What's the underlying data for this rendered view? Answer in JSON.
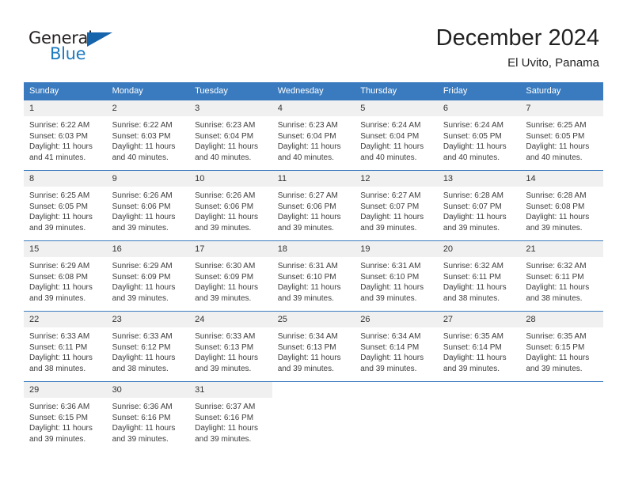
{
  "logo": {
    "word_top": "General",
    "word_bottom": "Blue",
    "triangle_color": "#1664ab",
    "blue_color": "#1c7ac0"
  },
  "header": {
    "title": "December 2024",
    "subtitle": "El Uvito, Panama"
  },
  "theme": {
    "header_bg": "#3a7bbf",
    "header_text": "#ffffff",
    "daynum_bg": "#f0f0f0",
    "cell_bg": "#ffffff",
    "text": "#3d3d3d"
  },
  "weekdays": [
    "Sunday",
    "Monday",
    "Tuesday",
    "Wednesday",
    "Thursday",
    "Friday",
    "Saturday"
  ],
  "weeks": [
    [
      {
        "day": "1",
        "sunrise": "Sunrise: 6:22 AM",
        "sunset": "Sunset: 6:03 PM",
        "daylight": "Daylight: 11 hours and 41 minutes."
      },
      {
        "day": "2",
        "sunrise": "Sunrise: 6:22 AM",
        "sunset": "Sunset: 6:03 PM",
        "daylight": "Daylight: 11 hours and 40 minutes."
      },
      {
        "day": "3",
        "sunrise": "Sunrise: 6:23 AM",
        "sunset": "Sunset: 6:04 PM",
        "daylight": "Daylight: 11 hours and 40 minutes."
      },
      {
        "day": "4",
        "sunrise": "Sunrise: 6:23 AM",
        "sunset": "Sunset: 6:04 PM",
        "daylight": "Daylight: 11 hours and 40 minutes."
      },
      {
        "day": "5",
        "sunrise": "Sunrise: 6:24 AM",
        "sunset": "Sunset: 6:04 PM",
        "daylight": "Daylight: 11 hours and 40 minutes."
      },
      {
        "day": "6",
        "sunrise": "Sunrise: 6:24 AM",
        "sunset": "Sunset: 6:05 PM",
        "daylight": "Daylight: 11 hours and 40 minutes."
      },
      {
        "day": "7",
        "sunrise": "Sunrise: 6:25 AM",
        "sunset": "Sunset: 6:05 PM",
        "daylight": "Daylight: 11 hours and 40 minutes."
      }
    ],
    [
      {
        "day": "8",
        "sunrise": "Sunrise: 6:25 AM",
        "sunset": "Sunset: 6:05 PM",
        "daylight": "Daylight: 11 hours and 39 minutes."
      },
      {
        "day": "9",
        "sunrise": "Sunrise: 6:26 AM",
        "sunset": "Sunset: 6:06 PM",
        "daylight": "Daylight: 11 hours and 39 minutes."
      },
      {
        "day": "10",
        "sunrise": "Sunrise: 6:26 AM",
        "sunset": "Sunset: 6:06 PM",
        "daylight": "Daylight: 11 hours and 39 minutes."
      },
      {
        "day": "11",
        "sunrise": "Sunrise: 6:27 AM",
        "sunset": "Sunset: 6:06 PM",
        "daylight": "Daylight: 11 hours and 39 minutes."
      },
      {
        "day": "12",
        "sunrise": "Sunrise: 6:27 AM",
        "sunset": "Sunset: 6:07 PM",
        "daylight": "Daylight: 11 hours and 39 minutes."
      },
      {
        "day": "13",
        "sunrise": "Sunrise: 6:28 AM",
        "sunset": "Sunset: 6:07 PM",
        "daylight": "Daylight: 11 hours and 39 minutes."
      },
      {
        "day": "14",
        "sunrise": "Sunrise: 6:28 AM",
        "sunset": "Sunset: 6:08 PM",
        "daylight": "Daylight: 11 hours and 39 minutes."
      }
    ],
    [
      {
        "day": "15",
        "sunrise": "Sunrise: 6:29 AM",
        "sunset": "Sunset: 6:08 PM",
        "daylight": "Daylight: 11 hours and 39 minutes."
      },
      {
        "day": "16",
        "sunrise": "Sunrise: 6:29 AM",
        "sunset": "Sunset: 6:09 PM",
        "daylight": "Daylight: 11 hours and 39 minutes."
      },
      {
        "day": "17",
        "sunrise": "Sunrise: 6:30 AM",
        "sunset": "Sunset: 6:09 PM",
        "daylight": "Daylight: 11 hours and 39 minutes."
      },
      {
        "day": "18",
        "sunrise": "Sunrise: 6:31 AM",
        "sunset": "Sunset: 6:10 PM",
        "daylight": "Daylight: 11 hours and 39 minutes."
      },
      {
        "day": "19",
        "sunrise": "Sunrise: 6:31 AM",
        "sunset": "Sunset: 6:10 PM",
        "daylight": "Daylight: 11 hours and 39 minutes."
      },
      {
        "day": "20",
        "sunrise": "Sunrise: 6:32 AM",
        "sunset": "Sunset: 6:11 PM",
        "daylight": "Daylight: 11 hours and 38 minutes."
      },
      {
        "day": "21",
        "sunrise": "Sunrise: 6:32 AM",
        "sunset": "Sunset: 6:11 PM",
        "daylight": "Daylight: 11 hours and 38 minutes."
      }
    ],
    [
      {
        "day": "22",
        "sunrise": "Sunrise: 6:33 AM",
        "sunset": "Sunset: 6:11 PM",
        "daylight": "Daylight: 11 hours and 38 minutes."
      },
      {
        "day": "23",
        "sunrise": "Sunrise: 6:33 AM",
        "sunset": "Sunset: 6:12 PM",
        "daylight": "Daylight: 11 hours and 38 minutes."
      },
      {
        "day": "24",
        "sunrise": "Sunrise: 6:33 AM",
        "sunset": "Sunset: 6:13 PM",
        "daylight": "Daylight: 11 hours and 39 minutes."
      },
      {
        "day": "25",
        "sunrise": "Sunrise: 6:34 AM",
        "sunset": "Sunset: 6:13 PM",
        "daylight": "Daylight: 11 hours and 39 minutes."
      },
      {
        "day": "26",
        "sunrise": "Sunrise: 6:34 AM",
        "sunset": "Sunset: 6:14 PM",
        "daylight": "Daylight: 11 hours and 39 minutes."
      },
      {
        "day": "27",
        "sunrise": "Sunrise: 6:35 AM",
        "sunset": "Sunset: 6:14 PM",
        "daylight": "Daylight: 11 hours and 39 minutes."
      },
      {
        "day": "28",
        "sunrise": "Sunrise: 6:35 AM",
        "sunset": "Sunset: 6:15 PM",
        "daylight": "Daylight: 11 hours and 39 minutes."
      }
    ],
    [
      {
        "day": "29",
        "sunrise": "Sunrise: 6:36 AM",
        "sunset": "Sunset: 6:15 PM",
        "daylight": "Daylight: 11 hours and 39 minutes."
      },
      {
        "day": "30",
        "sunrise": "Sunrise: 6:36 AM",
        "sunset": "Sunset: 6:16 PM",
        "daylight": "Daylight: 11 hours and 39 minutes."
      },
      {
        "day": "31",
        "sunrise": "Sunrise: 6:37 AM",
        "sunset": "Sunset: 6:16 PM",
        "daylight": "Daylight: 11 hours and 39 minutes."
      },
      {
        "day": "",
        "sunrise": "",
        "sunset": "",
        "daylight": ""
      },
      {
        "day": "",
        "sunrise": "",
        "sunset": "",
        "daylight": ""
      },
      {
        "day": "",
        "sunrise": "",
        "sunset": "",
        "daylight": ""
      },
      {
        "day": "",
        "sunrise": "",
        "sunset": "",
        "daylight": ""
      }
    ]
  ]
}
